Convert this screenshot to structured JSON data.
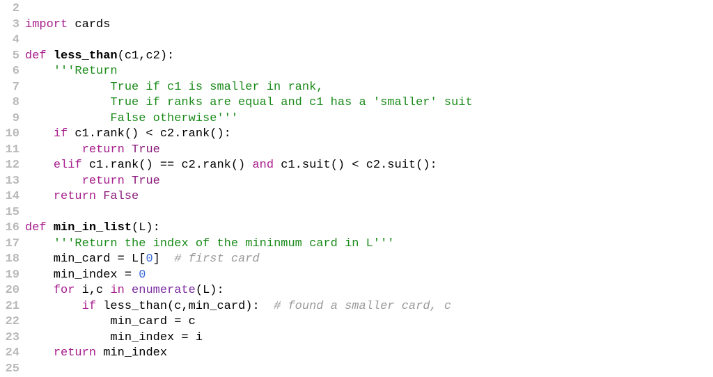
{
  "gutter": {
    "numbers": [
      "2",
      "3",
      "4",
      "5",
      "6",
      "7",
      "8",
      "9",
      "10",
      "11",
      "12",
      "13",
      "14",
      "15",
      "16",
      "17",
      "18",
      "19",
      "20",
      "21",
      "22",
      "23",
      "24",
      "25"
    ]
  },
  "lines": [
    {
      "i": 0,
      "segs": []
    },
    {
      "i": 1,
      "segs": [
        {
          "c": "kw",
          "t": "import"
        },
        {
          "c": "txt",
          "t": " cards"
        }
      ]
    },
    {
      "i": 2,
      "segs": []
    },
    {
      "i": 3,
      "segs": [
        {
          "c": "kw",
          "t": "def"
        },
        {
          "c": "txt",
          "t": " "
        },
        {
          "c": "fn",
          "t": "less_than"
        },
        {
          "c": "txt",
          "t": "(c1,c2):"
        }
      ]
    },
    {
      "i": 4,
      "segs": [
        {
          "c": "txt",
          "t": "    "
        },
        {
          "c": "str",
          "t": "'''Return"
        }
      ]
    },
    {
      "i": 5,
      "segs": [
        {
          "c": "str",
          "t": "            True if c1 is smaller in rank,"
        }
      ]
    },
    {
      "i": 6,
      "segs": [
        {
          "c": "str",
          "t": "            True if ranks are equal and c1 has a 'smaller' suit"
        }
      ]
    },
    {
      "i": 7,
      "segs": [
        {
          "c": "str",
          "t": "            False otherwise'''"
        }
      ]
    },
    {
      "i": 8,
      "segs": [
        {
          "c": "txt",
          "t": "    "
        },
        {
          "c": "kw",
          "t": "if"
        },
        {
          "c": "txt",
          "t": " c1.rank() < c2.rank():"
        }
      ]
    },
    {
      "i": 9,
      "segs": [
        {
          "c": "txt",
          "t": "        "
        },
        {
          "c": "kw",
          "t": "return"
        },
        {
          "c": "txt",
          "t": " "
        },
        {
          "c": "const",
          "t": "True"
        }
      ]
    },
    {
      "i": 10,
      "segs": [
        {
          "c": "txt",
          "t": "    "
        },
        {
          "c": "kw",
          "t": "elif"
        },
        {
          "c": "txt",
          "t": " c1.rank() == c2.rank() "
        },
        {
          "c": "kw",
          "t": "and"
        },
        {
          "c": "txt",
          "t": " c1.suit() < c2.suit():"
        }
      ]
    },
    {
      "i": 11,
      "segs": [
        {
          "c": "txt",
          "t": "        "
        },
        {
          "c": "kw",
          "t": "return"
        },
        {
          "c": "txt",
          "t": " "
        },
        {
          "c": "const",
          "t": "True"
        }
      ]
    },
    {
      "i": 12,
      "segs": [
        {
          "c": "txt",
          "t": "    "
        },
        {
          "c": "kw",
          "t": "return"
        },
        {
          "c": "txt",
          "t": " "
        },
        {
          "c": "const",
          "t": "False"
        }
      ]
    },
    {
      "i": 13,
      "segs": []
    },
    {
      "i": 14,
      "segs": [
        {
          "c": "kw",
          "t": "def"
        },
        {
          "c": "txt",
          "t": " "
        },
        {
          "c": "fn",
          "t": "min_in_list"
        },
        {
          "c": "txt",
          "t": "(L):"
        }
      ]
    },
    {
      "i": 15,
      "segs": [
        {
          "c": "txt",
          "t": "    "
        },
        {
          "c": "str",
          "t": "'''Return the index of the mininmum card in L'''"
        }
      ]
    },
    {
      "i": 16,
      "segs": [
        {
          "c": "txt",
          "t": "    min_card = L["
        },
        {
          "c": "num",
          "t": "0"
        },
        {
          "c": "txt",
          "t": "]  "
        },
        {
          "c": "comment",
          "t": "# first card"
        }
      ]
    },
    {
      "i": 17,
      "segs": [
        {
          "c": "txt",
          "t": "    min_index = "
        },
        {
          "c": "num",
          "t": "0"
        }
      ]
    },
    {
      "i": 18,
      "segs": [
        {
          "c": "txt",
          "t": "    "
        },
        {
          "c": "kw",
          "t": "for"
        },
        {
          "c": "txt",
          "t": " i,c "
        },
        {
          "c": "kw",
          "t": "in"
        },
        {
          "c": "txt",
          "t": " "
        },
        {
          "c": "builtin",
          "t": "enumerate"
        },
        {
          "c": "txt",
          "t": "(L):"
        }
      ]
    },
    {
      "i": 19,
      "segs": [
        {
          "c": "txt",
          "t": "        "
        },
        {
          "c": "kw",
          "t": "if"
        },
        {
          "c": "txt",
          "t": " less_than(c,min_card):  "
        },
        {
          "c": "comment",
          "t": "# found a smaller card, c"
        }
      ]
    },
    {
      "i": 20,
      "segs": [
        {
          "c": "txt",
          "t": "            min_card = c"
        }
      ]
    },
    {
      "i": 21,
      "segs": [
        {
          "c": "txt",
          "t": "            min_index = i"
        }
      ]
    },
    {
      "i": 22,
      "segs": [
        {
          "c": "txt",
          "t": "    "
        },
        {
          "c": "kw",
          "t": "return"
        },
        {
          "c": "txt",
          "t": " min_index"
        }
      ]
    },
    {
      "i": 23,
      "segs": []
    }
  ]
}
